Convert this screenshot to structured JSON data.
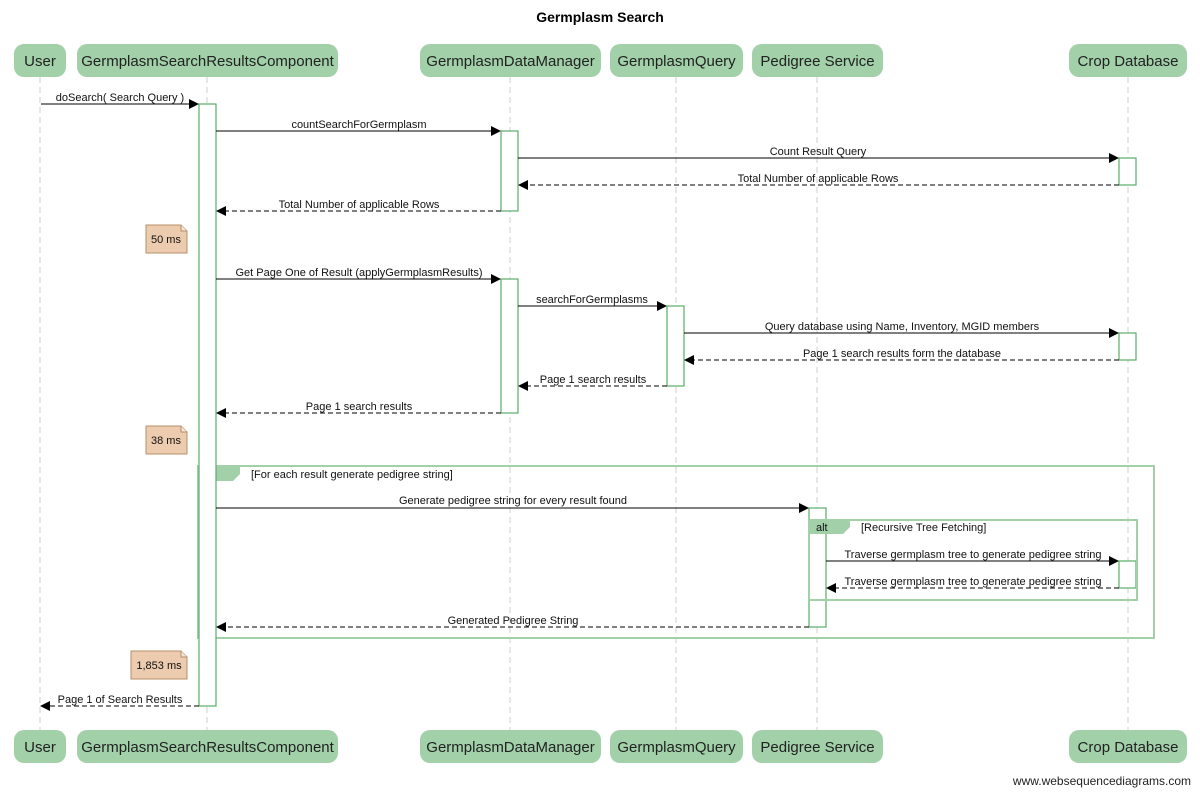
{
  "title": "Germplasm Search",
  "footer": "www.websequencediagrams.com",
  "participants": [
    {
      "id": "user",
      "label": "User"
    },
    {
      "id": "gsrc",
      "label": "GermplasmSearchResultsComponent"
    },
    {
      "id": "gdm",
      "label": "GermplasmDataManager"
    },
    {
      "id": "gq",
      "label": "GermplasmQuery"
    },
    {
      "id": "ps",
      "label": "Pedigree Service"
    },
    {
      "id": "cdb",
      "label": "Crop Database"
    }
  ],
  "messages": [
    {
      "from": "user",
      "to": "gsrc",
      "label": "doSearch( Search Query )",
      "type": "call"
    },
    {
      "from": "gsrc",
      "to": "gdm",
      "label": "countSearchForGermplasm",
      "type": "call"
    },
    {
      "from": "gdm",
      "to": "cdb",
      "label": "Count Result Query",
      "type": "call"
    },
    {
      "from": "cdb",
      "to": "gdm",
      "label": "Total Number of applicable Rows",
      "type": "return"
    },
    {
      "from": "gdm",
      "to": "gsrc",
      "label": "Total Number of applicable Rows",
      "type": "return"
    },
    {
      "from": "gsrc",
      "to": "gdm",
      "label": "Get Page One of Result (applyGermplasmResults)",
      "type": "call"
    },
    {
      "from": "gdm",
      "to": "gq",
      "label": "searchForGermplasms",
      "type": "call"
    },
    {
      "from": "gq",
      "to": "cdb",
      "label": "Query database using Name, Inventory, MGID members",
      "type": "call"
    },
    {
      "from": "cdb",
      "to": "gq",
      "label": "Page 1 search results form the database",
      "type": "return"
    },
    {
      "from": "gq",
      "to": "gdm",
      "label": "Page 1 search results",
      "type": "return"
    },
    {
      "from": "gdm",
      "to": "gsrc",
      "label": "Page 1 search results",
      "type": "return"
    },
    {
      "from": "gsrc",
      "to": "ps",
      "label": "Generate pedigree string for every result found",
      "type": "call"
    },
    {
      "from": "ps",
      "to": "cdb",
      "label": "Traverse germplasm tree to generate pedigree string",
      "type": "call"
    },
    {
      "from": "cdb",
      "to": "ps",
      "label": "Traverse germplasm tree to generate pedigree string",
      "type": "return"
    },
    {
      "from": "ps",
      "to": "gsrc",
      "label": "Generated Pedigree String",
      "type": "return"
    },
    {
      "from": "gsrc",
      "to": "user",
      "label": "Page 1 of Search Results",
      "type": "return"
    }
  ],
  "notes": [
    {
      "label": "50 ms"
    },
    {
      "label": "38 ms"
    },
    {
      "label": "1,853 ms"
    }
  ],
  "frames": [
    {
      "kind": "alt",
      "condition": "[For each result generate pedigree string]"
    },
    {
      "kind": "alt",
      "condition": "[Recursive Tree Fetching]"
    }
  ]
}
